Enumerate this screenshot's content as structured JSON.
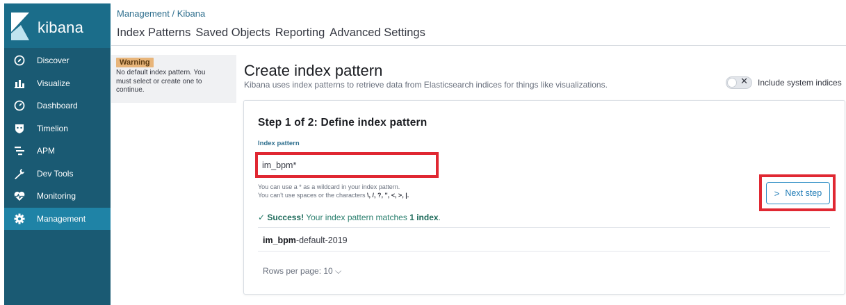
{
  "app": {
    "logo_text": "kibana"
  },
  "sidebar": {
    "items": [
      {
        "label": "Discover",
        "icon": "compass-icon"
      },
      {
        "label": "Visualize",
        "icon": "bar-chart-icon"
      },
      {
        "label": "Dashboard",
        "icon": "dashboard-icon"
      },
      {
        "label": "Timelion",
        "icon": "shield-icon"
      },
      {
        "label": "APM",
        "icon": "apm-icon"
      },
      {
        "label": "Dev Tools",
        "icon": "wrench-icon"
      },
      {
        "label": "Monitoring",
        "icon": "heartbeat-icon"
      },
      {
        "label": "Management",
        "icon": "gear-icon"
      }
    ],
    "active": "Management"
  },
  "header": {
    "breadcrumb": [
      "Management",
      "Kibana"
    ],
    "breadcrumb_sep": " / ",
    "tabs": [
      "Index Patterns",
      "Saved Objects",
      "Reporting",
      "Advanced Settings"
    ]
  },
  "warning": {
    "badge": "Warning",
    "text": "No default index pattern. You must select or create one to continue."
  },
  "main": {
    "title": "Create index pattern",
    "description": "Kibana uses index patterns to retrieve data from Elasticsearch indices for things like visualizations.",
    "include_system_indices": "Include system indices"
  },
  "step": {
    "title": "Step 1 of 2: Define index pattern",
    "field_label": "Index pattern",
    "input_value": "im_bpm*",
    "help_line1": "You can use a * as a wildcard in your index pattern.",
    "help_line2_prefix": "You can't use spaces or the characters ",
    "help_line2_chars": "\\, /, ?, \", <, >, |.",
    "next_button": "Next step",
    "success_label": "Success!",
    "success_text_prefix": " Your index pattern matches ",
    "success_count": "1 index",
    "success_text_suffix": ".",
    "index_match_bold": "im_bpm",
    "index_match_rest": "-default-2019",
    "rows_per_page": "Rows per page: 10"
  },
  "colors": {
    "sidebar_bg": "#1a5a73",
    "sidebar_active": "#1f83a6",
    "highlight_red": "#e02832",
    "primary_blue": "#1f7bb6",
    "success_green": "#2a7f6e",
    "warning_badge": "#e8b57a"
  }
}
